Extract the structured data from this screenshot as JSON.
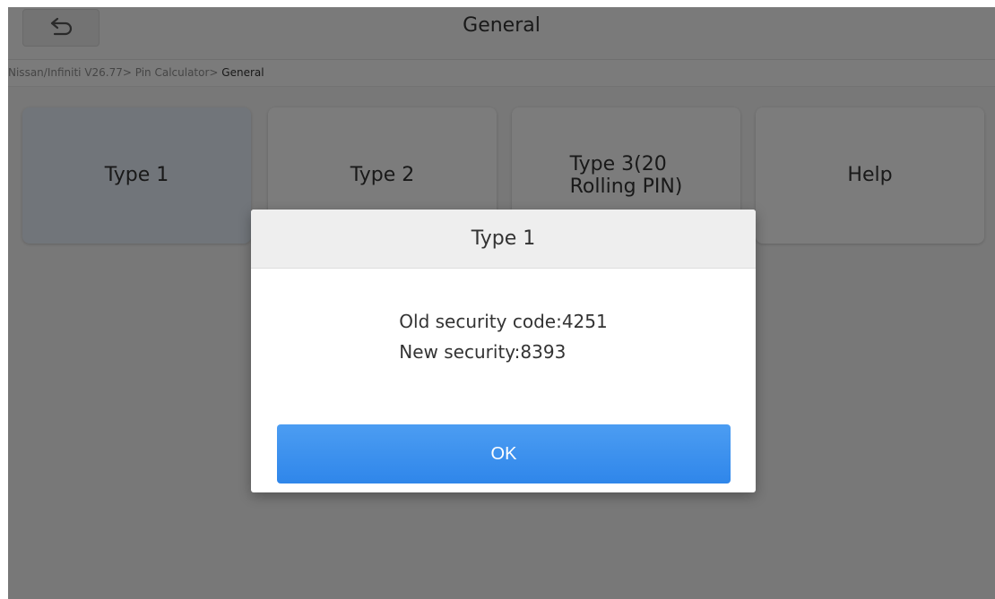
{
  "header": {
    "title": "General",
    "back_icon": "undo-arrow-icon"
  },
  "breadcrumb": {
    "path": "Nissan/Infiniti V26.77> Pin Calculator> ",
    "current": "General"
  },
  "tiles": [
    {
      "label": "Type 1",
      "selected": true
    },
    {
      "label": "Type 2",
      "selected": false
    },
    {
      "label": "Type 3(20\nRolling PIN)",
      "selected": false
    },
    {
      "label": "Help",
      "selected": false
    }
  ],
  "dialog": {
    "title": "Type 1",
    "lines": [
      "Old security code:4251",
      "New security:8393"
    ],
    "ok_label": "OK"
  },
  "colors": {
    "accent": "#3a90ee",
    "overlay": "rgba(0,0,0,0.5)"
  }
}
